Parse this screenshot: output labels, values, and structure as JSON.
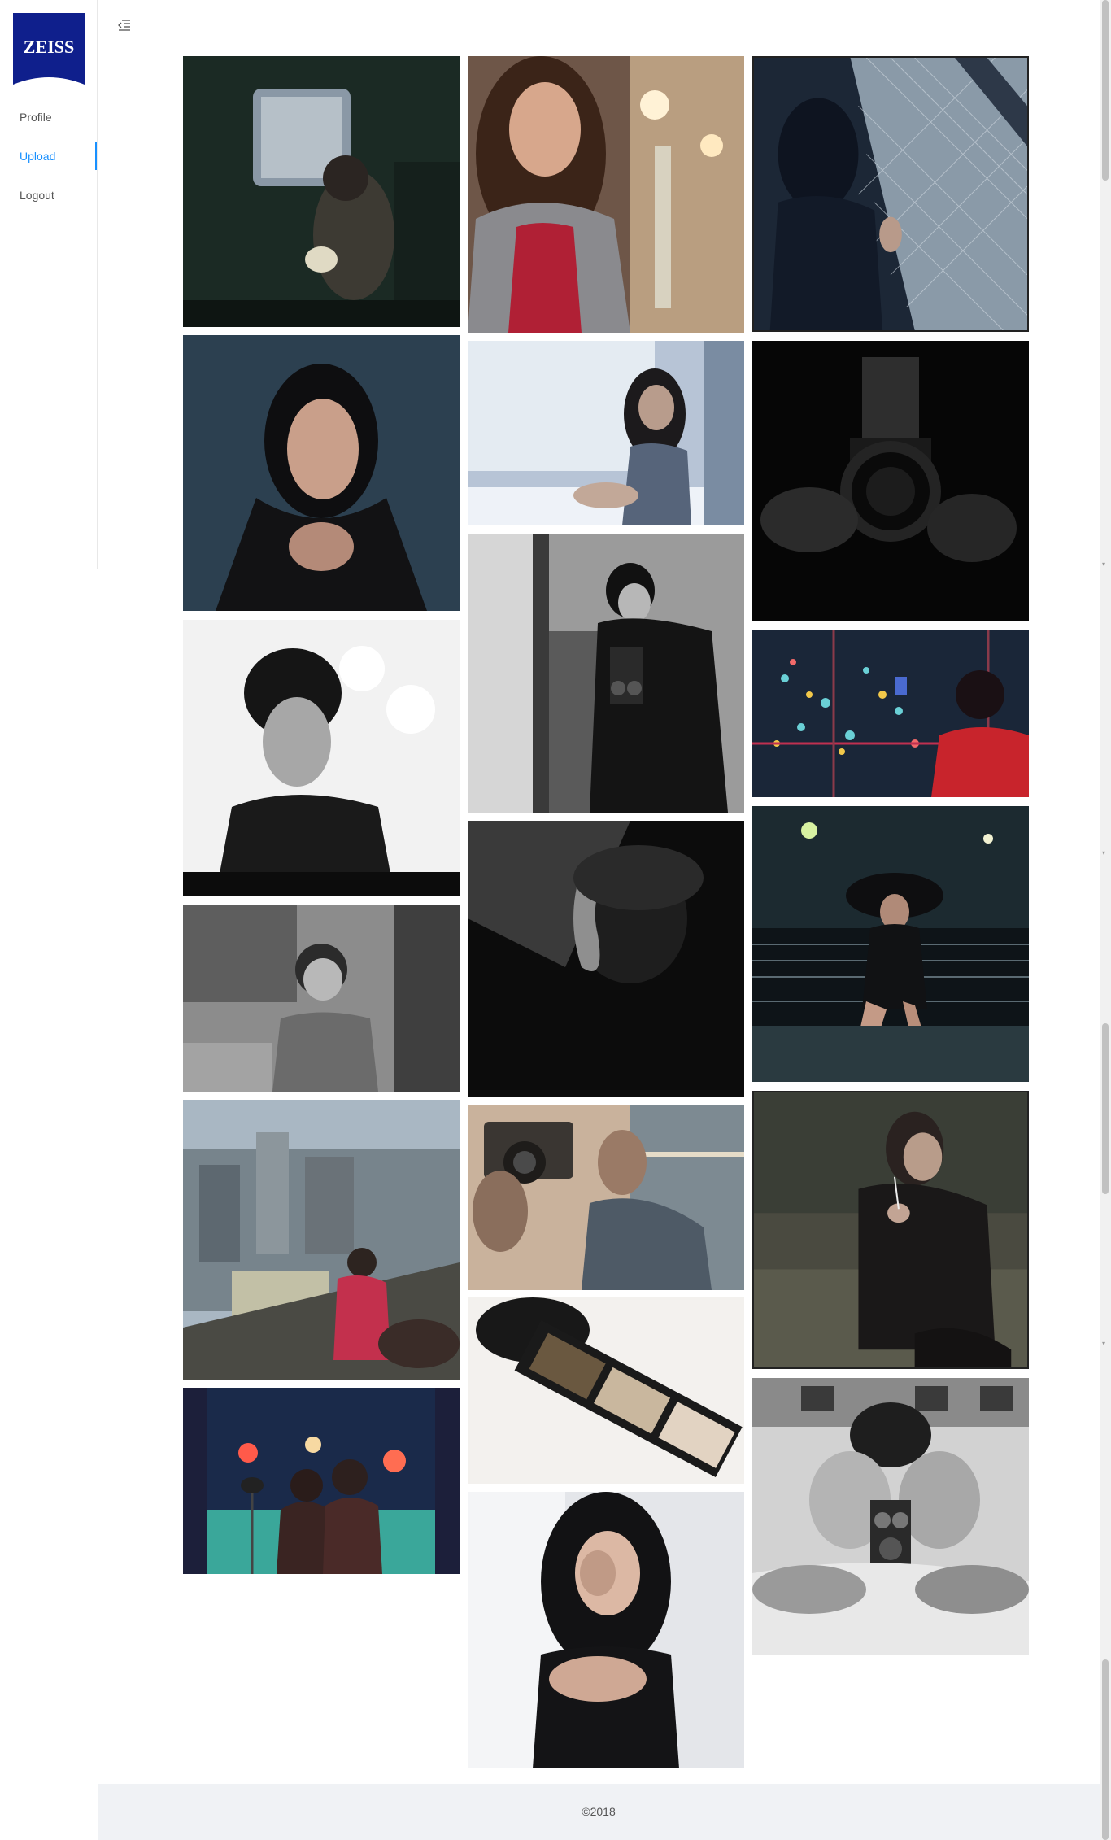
{
  "brand": {
    "logo_text": "ZEISS",
    "color": "#0f1f8c"
  },
  "nav": {
    "items": [
      {
        "label": "Profile",
        "active": false
      },
      {
        "label": "Upload",
        "active": true
      },
      {
        "label": "Logout",
        "active": false
      }
    ],
    "active_color": "#1890ff"
  },
  "toolbar": {
    "toggle_icon": "menu-fold-icon"
  },
  "gallery": {
    "columns": [
      [
        {
          "subject": "woman-with-hat-by-train-window",
          "tone": "dark-green"
        },
        {
          "subject": "asian-woman-portrait-dark-hair",
          "tone": "blue"
        },
        {
          "subject": "woman-short-hair-bright-bokeh",
          "tone": "bw-bright"
        },
        {
          "subject": "young-boy-outdoors",
          "tone": "bw"
        },
        {
          "subject": "girl-looking-out-at-city",
          "tone": "color"
        },
        {
          "subject": "children-watching-stage-lights",
          "tone": "teal-red"
        }
      ],
      [
        {
          "subject": "woman-pouting-in-mall",
          "tone": "warm"
        },
        {
          "subject": "woman-sitting-by-window",
          "tone": "cool"
        },
        {
          "subject": "woman-with-twin-lens-camera-mirror",
          "tone": "bw"
        },
        {
          "subject": "woman-profile-in-shadow",
          "tone": "bw-dark"
        },
        {
          "subject": "hands-holding-rangefinder-camera",
          "tone": "warm-muted"
        },
        {
          "subject": "film-strip-negative",
          "tone": "bright"
        },
        {
          "subject": "woman-laughing-covering-face",
          "tone": "bright-gray"
        }
      ],
      [
        {
          "subject": "woman-silhouette-by-fence",
          "tone": "dark-blue"
        },
        {
          "subject": "hands-holding-medium-format-camera",
          "tone": "bw-dark"
        },
        {
          "subject": "woman-photographing-city-at-night",
          "tone": "night"
        },
        {
          "subject": "woman-with-hat-on-bench",
          "tone": "dark-teal"
        },
        {
          "subject": "woman-smoking-in-park",
          "tone": "muted"
        },
        {
          "subject": "man-with-twin-lens-camera",
          "tone": "bw"
        }
      ]
    ]
  },
  "footer": {
    "text": "©2018"
  }
}
